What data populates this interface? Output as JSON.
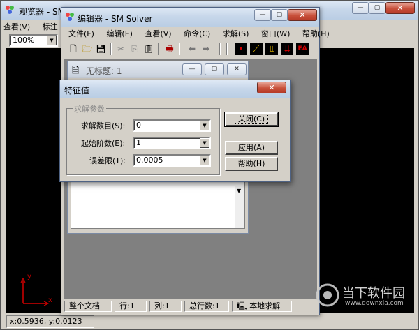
{
  "viewer": {
    "title": "观览器 - SM Solv",
    "menu": [
      "查看(V)",
      "标注"
    ],
    "zoom": "100%",
    "coords": "x:0.5936, y:0.0123",
    "axis_y": "y",
    "axis_x": "x"
  },
  "editor": {
    "title": "编辑器 - SM Solver",
    "menu": [
      "文件(F)",
      "编辑(E)",
      "查看(V)",
      "命令(C)",
      "求解(S)",
      "窗口(W)",
      "帮助(H)"
    ],
    "toolbar_labels": {
      "ea": "EA"
    },
    "status": [
      "整个文档",
      "行:1",
      "列:1",
      "总行数:1",
      "本地求解"
    ],
    "child": {
      "title": "无标题: 1"
    }
  },
  "dialog": {
    "title": "特征值",
    "group": "求解参数",
    "fields": [
      {
        "label": "求解数目(S):",
        "value": "0"
      },
      {
        "label": "起始阶数(E):",
        "value": "1"
      },
      {
        "label": "误差限(T):",
        "value": "0.0005"
      }
    ],
    "buttons": {
      "close": "关闭(C)",
      "apply": "应用(A)",
      "help": "帮助(H)"
    }
  },
  "watermark": {
    "title": "当下软件园",
    "url": "www.downxia.com"
  },
  "colors": {
    "accent": "#3a6ea5",
    "red": "#d40000",
    "canvas": "#000000"
  }
}
